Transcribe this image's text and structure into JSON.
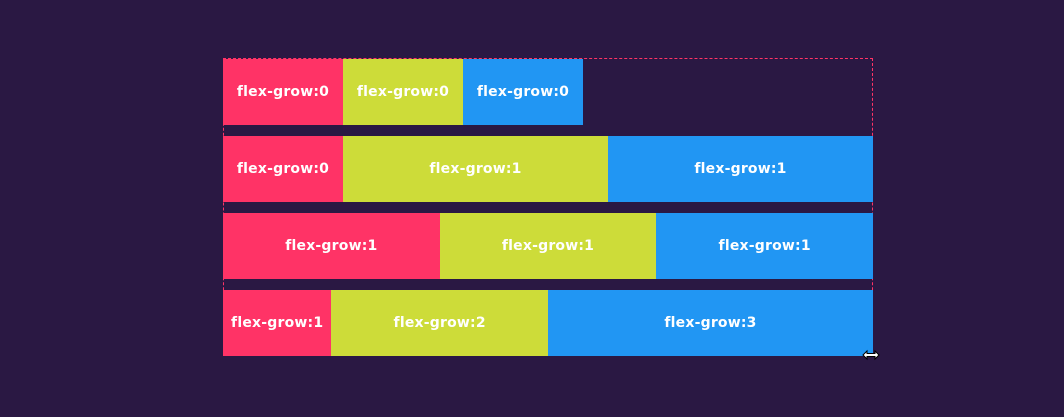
{
  "colors": {
    "background": "#2a1843",
    "item_1": "#ff3366",
    "item_2": "#cddc39",
    "item_3": "#2196f3",
    "container_border": "#ff3366"
  },
  "rows": [
    {
      "items": [
        {
          "label": "flex-grow:0",
          "grow": 0
        },
        {
          "label": "flex-grow:0",
          "grow": 0
        },
        {
          "label": "flex-grow:0",
          "grow": 0
        }
      ]
    },
    {
      "items": [
        {
          "label": "flex-grow:0",
          "grow": 0
        },
        {
          "label": "flex-grow:1",
          "grow": 1
        },
        {
          "label": "flex-grow:1",
          "grow": 1
        }
      ]
    },
    {
      "items": [
        {
          "label": "flex-grow:1",
          "grow": 1
        },
        {
          "label": "flex-grow:1",
          "grow": 1
        },
        {
          "label": "flex-grow:1",
          "grow": 1
        }
      ]
    },
    {
      "items": [
        {
          "label": "flex-grow:1",
          "grow": 1
        },
        {
          "label": "flex-grow:2",
          "grow": 2
        },
        {
          "label": "flex-grow:3",
          "grow": 3
        }
      ]
    }
  ],
  "cursor": {
    "icon": "resize-horizontal-cursor-icon"
  }
}
